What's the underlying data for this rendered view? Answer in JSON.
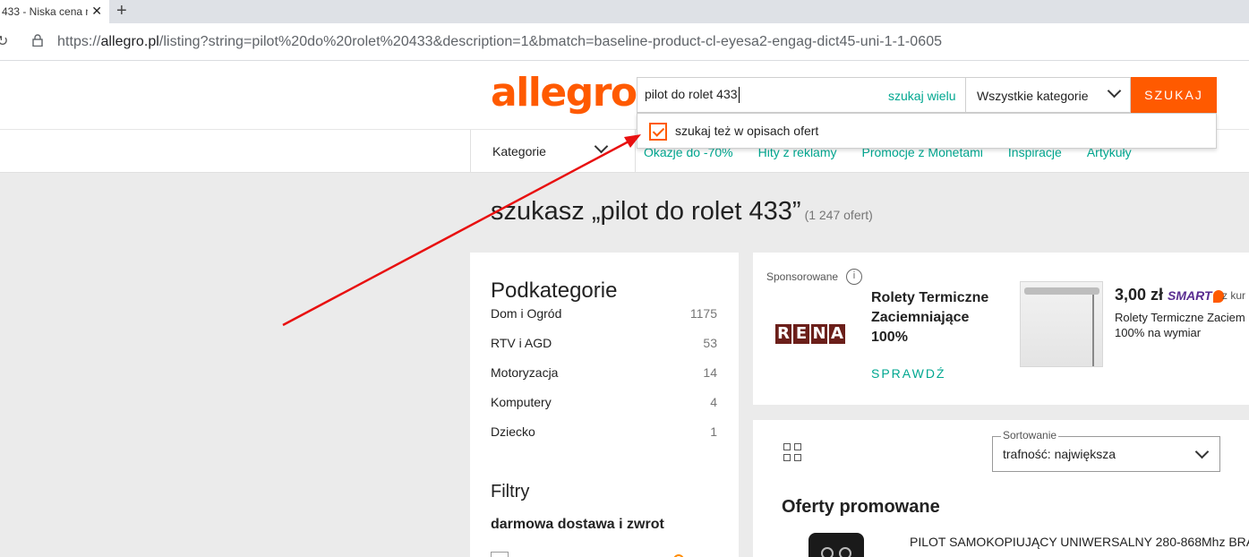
{
  "browser": {
    "tab_title": "433 - Niska cena na",
    "url_prefix": "https://",
    "url_host": "allegro.pl",
    "url_path": "/listing?string=pilot%20do%20rolet%20433&description=1&bmatch=baseline-product-cl-eyesa2-engag-dict45-uni-1-1-0605"
  },
  "header": {
    "logo": "allegro",
    "search_value": "pilot do rolet 433",
    "search_many": "szukaj wielu",
    "category_select": "Wszystkie kategorie",
    "search_button": "SZUKAJ",
    "search_in_descriptions": "szukaj też w opisach ofert",
    "search_in_descriptions_checked": true
  },
  "nav": {
    "categories": "Kategorie",
    "links": [
      "Okazje do -70%",
      "Hity z reklamy",
      "Promocje z Monetami",
      "Inspiracje",
      "Artykuły"
    ]
  },
  "main": {
    "heading": "szukasz „pilot do rolet 433”",
    "result_count": "(1 247 ofert)"
  },
  "subcategories": {
    "title": "Podkategorie",
    "items": [
      {
        "label": "Dom i Ogród",
        "count": "1175"
      },
      {
        "label": "RTV i AGD",
        "count": "53"
      },
      {
        "label": "Motoryzacja",
        "count": "14"
      },
      {
        "label": "Komputery",
        "count": "4"
      },
      {
        "label": "Dziecko",
        "count": "1"
      }
    ]
  },
  "filters": {
    "title": "Filtry",
    "group": "darmowa dostawa i zwrot"
  },
  "ad": {
    "sponsored": "Sponsorowane",
    "info": "i",
    "brand_letters": [
      "R",
      "E",
      "N",
      "A"
    ],
    "title": "Rolety Termiczne Zaciemniające 100%",
    "cta": "SPRAWDŹ",
    "price": "3,00 zł",
    "smart": "SMART",
    "smart_extra": "z kur",
    "desc_line1": "Rolety Termiczne Zaciem",
    "desc_line2": "100% na wymiar"
  },
  "offers": {
    "sort_label": "Sortowanie",
    "sort_value": "trafność: największa",
    "promoted_title": "Oferty promowane",
    "first_offer_title": "PILOT SAMOKOPIUJĄCY UNIWERSALNY 280-868Mhz BRAM"
  },
  "colors": {
    "brand_orange": "#ff5a00",
    "link_teal": "#00a790",
    "annotation_red": "#e81010"
  }
}
